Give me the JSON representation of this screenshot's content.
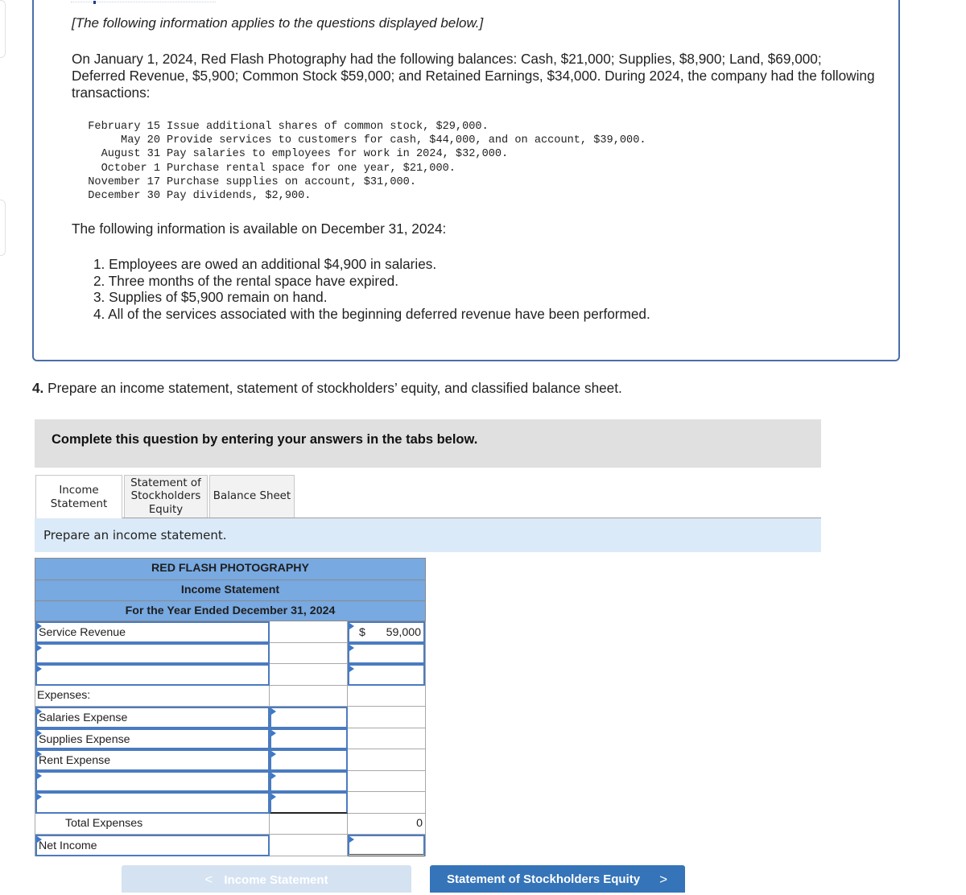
{
  "context": {
    "intro": "[The following information applies to the questions displayed below.]",
    "paragraph": "On January 1, 2024, Red Flash Photography had the following balances: Cash, $21,000; Supplies, $8,900; Land, $69,000; Deferred Revenue, $5,900; Common Stock $59,000; and Retained Earnings, $34,000. During 2024, the company had the following transactions:",
    "transactions": [
      {
        "date": "February 15",
        "text": "Issue additional shares of common stock, $29,000."
      },
      {
        "date": "May 20",
        "text": "Provide services to customers for cash, $44,000, and on account, $39,000."
      },
      {
        "date": "August 31",
        "text": "Pay salaries to employees for work in 2024, $32,000."
      },
      {
        "date": "October 1",
        "text": "Purchase rental space for one year, $21,000."
      },
      {
        "date": "November 17",
        "text": "Purchase supplies on account, $31,000."
      },
      {
        "date": "December 30",
        "text": "Pay dividends, $2,900."
      }
    ],
    "available_intro": "The following information is available on December 31, 2024:",
    "adjustments": [
      "1. Employees are owed an additional $4,900 in salaries.",
      "2. Three months of the rental space have expired.",
      "3. Supplies of $5,900 remain on hand.",
      "4. All of the services associated with the beginning deferred revenue have been performed."
    ]
  },
  "question": {
    "number": "4.",
    "text": " Prepare an income statement, statement of stockholders’ equity, and classified balance sheet."
  },
  "banner": "Complete this question by entering your answers in the tabs below.",
  "tabs": [
    {
      "label": "Income\nStatement",
      "active": true
    },
    {
      "label": "Statement of\nStockholders\nEquity",
      "active": false
    },
    {
      "label": "Balance Sheet",
      "active": false
    }
  ],
  "instruction": "Prepare an income statement.",
  "statement": {
    "company": "RED FLASH PHOTOGRAPHY",
    "title": "Income Statement",
    "period": "For the Year Ended December 31, 2024",
    "rows": [
      {
        "label": "Service Revenue",
        "col2": "",
        "col3_prefix": "$",
        "col3": "59,000"
      },
      {
        "label": "",
        "col2": "",
        "col3": ""
      },
      {
        "label": "",
        "col2": "",
        "col3": ""
      },
      {
        "label": "Expenses:",
        "col2": "",
        "col3": ""
      },
      {
        "label": "Salaries Expense",
        "col2": "",
        "col3": ""
      },
      {
        "label": "Supplies Expense",
        "col2": "",
        "col3": ""
      },
      {
        "label": "Rent Expense",
        "col2": "",
        "col3": ""
      },
      {
        "label": "",
        "col2": "",
        "col3": ""
      },
      {
        "label": "",
        "col2": "",
        "col3": ""
      },
      {
        "label": "Total Expenses",
        "col2": "",
        "col3": "0"
      },
      {
        "label": "Net Income",
        "col2": "",
        "col3": ""
      }
    ]
  },
  "nav": {
    "prev_label": "Income Statement",
    "prev_icon": "chevron-left-icon",
    "next_label": "Statement of Stockholders Equity",
    "next_icon": "chevron-right-icon",
    "prev_glyph": "<",
    "next_glyph": ">"
  }
}
